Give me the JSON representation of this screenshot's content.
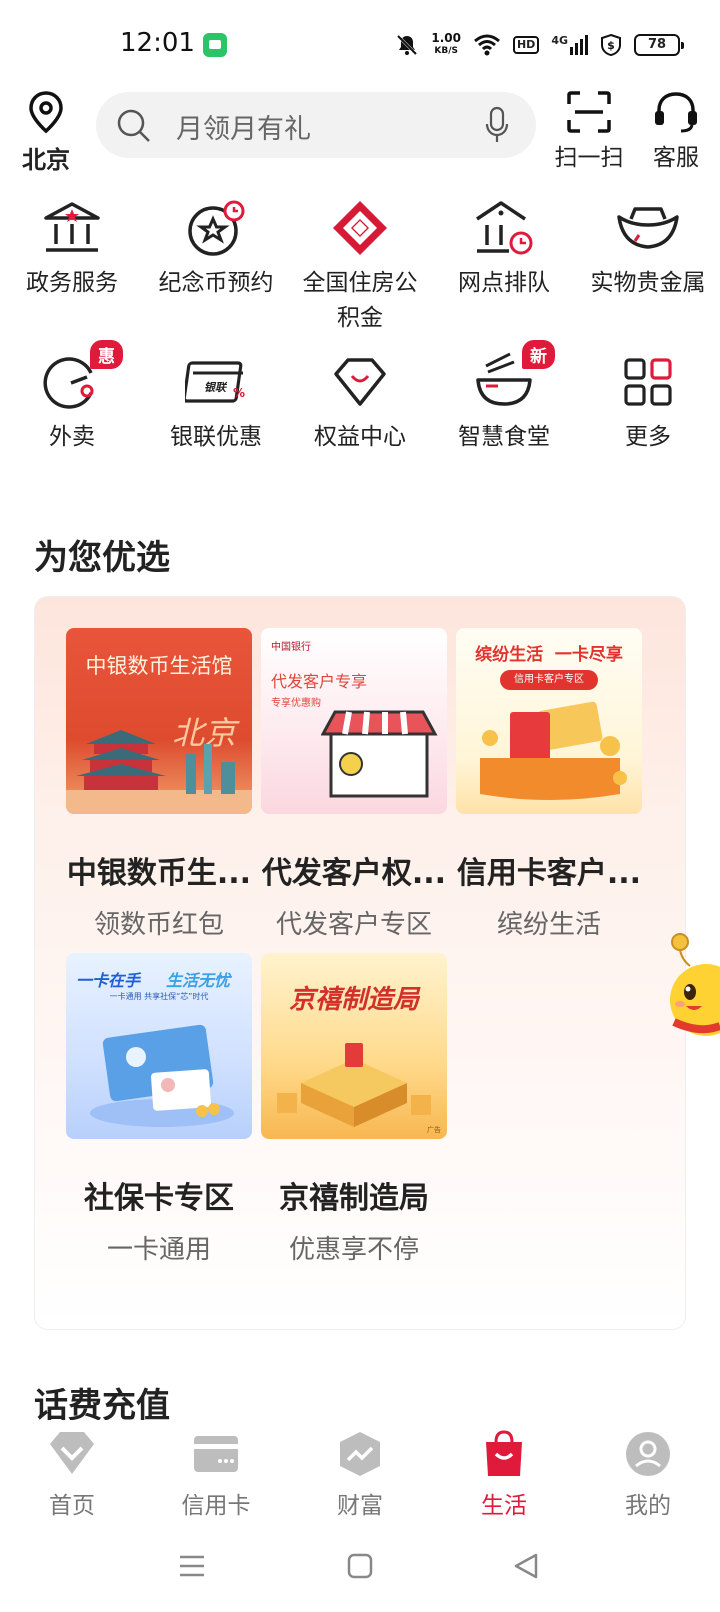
{
  "status": {
    "time": "12:01",
    "speed_top": "1.00",
    "speed_unit": "KB/S",
    "hd": "HD",
    "net": "4G",
    "battery": "78"
  },
  "location": {
    "city": "北京"
  },
  "search": {
    "placeholder": "月领月有礼"
  },
  "top_actions": {
    "scan": "扫一扫",
    "service": "客服"
  },
  "grid_row1": [
    {
      "label": "政务服务",
      "icon": "government-icon"
    },
    {
      "label": "纪念币预约",
      "icon": "coin-star-icon"
    },
    {
      "label": "全国住房公积金",
      "icon": "housing-fund-icon"
    },
    {
      "label": "网点排队",
      "icon": "branch-queue-icon"
    },
    {
      "label": "实物贵金属",
      "icon": "gold-ingot-icon"
    }
  ],
  "grid_row2": [
    {
      "label": "外卖",
      "icon": "takeout-icon",
      "badge": "惠"
    },
    {
      "label": "银联优惠",
      "icon": "unionpay-card-icon",
      "card_text": "银联"
    },
    {
      "label": "权益中心",
      "icon": "diamond-icon"
    },
    {
      "label": "智慧食堂",
      "icon": "bowl-icon",
      "badge": "新"
    },
    {
      "label": "更多",
      "icon": "grid-more-icon"
    }
  ],
  "sections": {
    "featured": "为您优选",
    "recharge": "话费充值"
  },
  "products": [
    {
      "title": "中银数币生...",
      "subtitle": "领数币红包",
      "img_text_1": "中银数币生活馆",
      "img_text_2": "北京"
    },
    {
      "title": "代发客户权...",
      "subtitle": "代发客户专区",
      "img_text_1": "代发客户专享",
      "img_text_2": "专享优惠购",
      "img_text_3": "中国银行"
    },
    {
      "title": "信用卡客户...",
      "subtitle": "缤纷生活",
      "img_text_1": "缤纷生活  一卡尽享",
      "img_text_2": "信用卡客户专区"
    },
    {
      "title": "社保卡专区",
      "subtitle": "一卡通用",
      "img_text_1": "一卡在手",
      "img_text_2": "生活无忧",
      "img_text_3": "一卡通用 共享社保“芯”时代"
    },
    {
      "title": "京禧制造局",
      "subtitle": "优惠享不停",
      "img_text_1": "京禧制造局",
      "img_text_2": "广告"
    }
  ],
  "tabs": [
    {
      "label": "首页",
      "icon": "home-diamond-icon"
    },
    {
      "label": "信用卡",
      "icon": "credit-card-icon"
    },
    {
      "label": "财富",
      "icon": "wealth-icon"
    },
    {
      "label": "生活",
      "icon": "shopping-bag-icon",
      "active": true
    },
    {
      "label": "我的",
      "icon": "profile-icon"
    }
  ],
  "colors": {
    "accent": "#e01a3b",
    "tab_inactive": "#777777",
    "panel_top": "#fde5dc"
  }
}
